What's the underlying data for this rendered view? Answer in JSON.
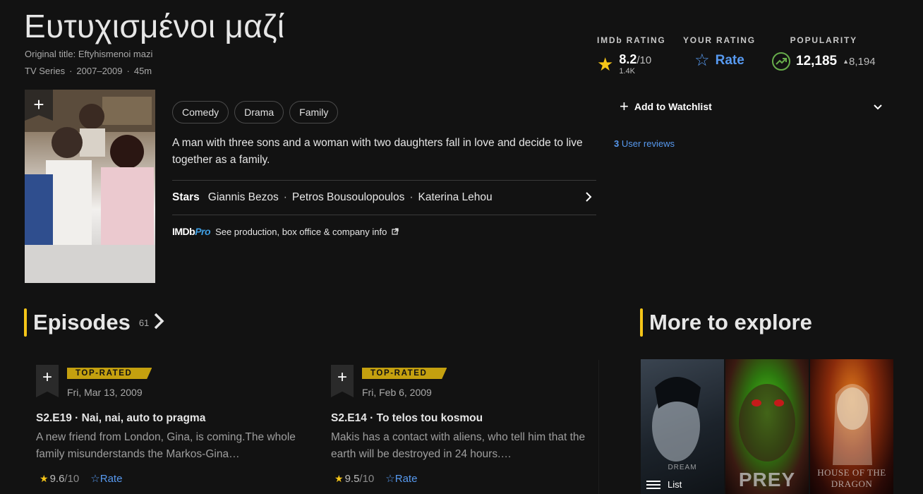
{
  "header": {
    "title": "Ευτυχισμένοι μαζί",
    "original_title": "Original title: Eftyhismenoi mazi",
    "meta": [
      "TV Series",
      "2007–2009",
      "45m"
    ]
  },
  "ratings": {
    "imdb_label": "IMDb RATING",
    "imdb_score": "8.2",
    "imdb_denom": "/10",
    "imdb_votes": "1.4K",
    "your_label": "YOUR RATING",
    "your_action": "Rate",
    "popularity_label": "POPULARITY",
    "popularity_value": "12,185",
    "popularity_delta": "8,194"
  },
  "genres": [
    "Comedy",
    "Drama",
    "Family"
  ],
  "plot": "A man with three sons and a woman with two daughters fall in love and decide to live together as a family.",
  "stars": {
    "label": "Stars",
    "names": [
      "Giannis Bezos",
      "Petros Bousoulopoulos",
      "Katerina Lehou"
    ]
  },
  "imdbpro": {
    "logo_a": "IMDb",
    "logo_b": "Pro",
    "text": "See production, box office & company info"
  },
  "watchlist": {
    "label": "Add to Watchlist"
  },
  "reviews": {
    "count": "3",
    "label": "User reviews"
  },
  "episodes": {
    "heading": "Episodes",
    "count": "61",
    "items": [
      {
        "badge": "TOP-RATED",
        "date": "Fri, Mar 13, 2009",
        "code": "S2.E19",
        "name": "Nai, nai, auto to pragma",
        "desc": "A new friend from London, Gina, is coming.The whole family misunderstands the Markos-Gina…",
        "rating": "9.6",
        "denom": "/10",
        "rate_label": "Rate"
      },
      {
        "badge": "TOP-RATED",
        "date": "Fri, Feb 6, 2009",
        "code": "S2.E14",
        "name": "To telos tou kosmou",
        "desc": "Makis has a contact with aliens, who tell him that the earth will be destroyed in 24 hours.…",
        "rating": "9.5",
        "denom": "/10",
        "rate_label": "Rate"
      }
    ]
  },
  "explore": {
    "heading": "More to explore",
    "list_label": "List",
    "tiles": [
      {
        "name": "sandman",
        "caption": "DREAM"
      },
      {
        "name": "prey",
        "caption": "PREY"
      },
      {
        "name": "house-of-the-dragon",
        "caption": "HOUSE OF THE DRAGON"
      }
    ]
  },
  "colors": {
    "background": "#121212",
    "accent_gold": "#f5c518",
    "link_blue": "#5799ef",
    "trend_green": "#67ad4b"
  }
}
